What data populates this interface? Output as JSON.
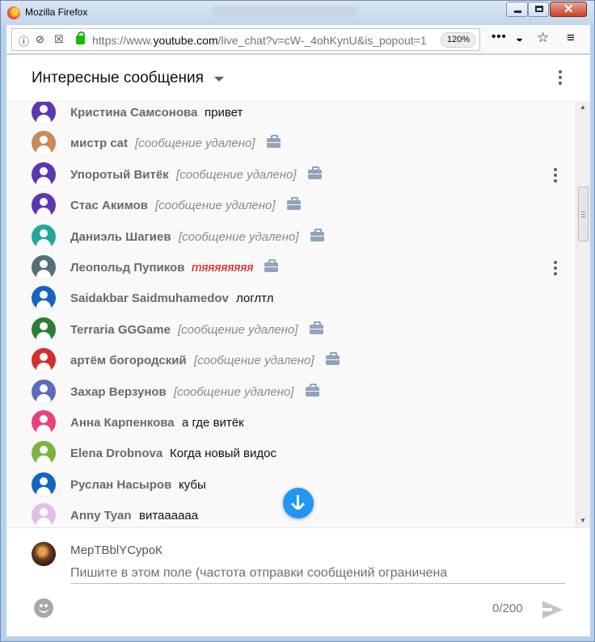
{
  "window": {
    "title": "Mozilla Firefox",
    "controls": {
      "minimize": "",
      "maximize": "",
      "close": "✕"
    }
  },
  "browser": {
    "url_prefix": "https://www.",
    "url_domain": "youtube.com",
    "url_rest": "/live_chat?v=cW-_4ohKynU&is_popout=1",
    "zoom": "120%",
    "icons": [
      "info-icon",
      "autoplay-blocked-icon",
      "tracking-icon",
      "lock-icon",
      "page-actions-icon",
      "pocket-icon",
      "bookmark-star-icon",
      "hamburger-menu-icon"
    ]
  },
  "chat": {
    "header_title": "Интересные сообщения",
    "messages": [
      {
        "author": "Кристина Самсонова",
        "text": "привет",
        "kind": "text",
        "avatar": "#5e35b1"
      },
      {
        "author": "мистр cat",
        "text": "[сообщение удалено]",
        "kind": "deleted",
        "avatar": "#c98a55"
      },
      {
        "author": "Упоротый Витёк",
        "text": "[сообщение удалено]",
        "kind": "deleted",
        "avatar": "#5e35b1",
        "menu": true
      },
      {
        "author": "Стас Акимов",
        "text": "[сообщение удалено]",
        "kind": "deleted",
        "avatar": "#5e35b1"
      },
      {
        "author": "Даниэль Шагиев",
        "text": "[сообщение удалено]",
        "kind": "deleted",
        "avatar": "#26a69a"
      },
      {
        "author": "Леопольд Пупиков",
        "text": "тяяяяяяяя",
        "kind": "red",
        "avatar": "#546e7a",
        "menu": true
      },
      {
        "author": "Saidakbar Saidmuhamedov",
        "text": "логлтл",
        "kind": "text",
        "avatar": "#1565c0"
      },
      {
        "author": "Terraria GGGame",
        "text": "[сообщение удалено]",
        "kind": "deleted",
        "avatar": "#2e7d32"
      },
      {
        "author": "артём богородский",
        "text": "[сообщение удалено]",
        "kind": "deleted",
        "avatar": "#d32f2f"
      },
      {
        "author": "Захар Верзунов",
        "text": "[сообщение удалено]",
        "kind": "deleted",
        "avatar": "#5c6bc0"
      },
      {
        "author": "Анна Карпенкова",
        "text": "а где витёк",
        "kind": "text",
        "avatar": "#ec407a"
      },
      {
        "author": "Elena Drobnova",
        "text": "Когда новый видос",
        "kind": "text",
        "avatar": "#7cb342"
      },
      {
        "author": "Руслан Насыров",
        "text": "кубы",
        "kind": "text",
        "avatar": "#1565c0"
      },
      {
        "author": "Anny Tyan",
        "text": "витаааааа",
        "kind": "text",
        "avatar": "#e1bee7"
      }
    ]
  },
  "composer": {
    "user_name": "МерТВblYСуроК",
    "placeholder": "Пишите в этом поле (частота отправки сообщений ограничена",
    "counter": "0/200"
  },
  "colors": {
    "accent_blue": "#2196f3",
    "deleted_text": "#8a8a8a",
    "highlight_red": "#e00000"
  }
}
